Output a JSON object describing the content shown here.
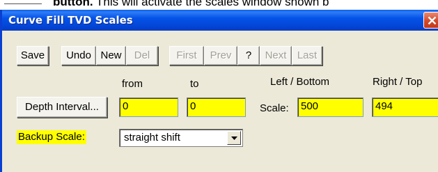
{
  "document": {
    "partial_bold": "button.",
    "partial_text": " This will activate the scales window shown b"
  },
  "window": {
    "title": "Curve Fill TVD Scales"
  },
  "toolbar": {
    "save_label": "Save",
    "undo_label": "Undo",
    "new_label": "New",
    "del_label": "Del",
    "first_label": "First",
    "prev_label": "Prev",
    "help_label": "?",
    "next_label": "Next",
    "last_label": "Last"
  },
  "depth": {
    "button_label": "Depth Interval...",
    "from_label": "from",
    "to_label": "to",
    "from_value": "0",
    "to_value": "0"
  },
  "scale": {
    "label": "Scale:",
    "left_bottom_label": "Left / Bottom",
    "right_top_label": "Right / Top",
    "left_bottom_value": "500",
    "right_top_value": "494"
  },
  "backup": {
    "label": "Backup Scale:",
    "selected": "straight shift"
  },
  "colors": {
    "title_bar": "#0553e8",
    "highlight": "#ffff00",
    "dialog_bg": "#ece9d8",
    "close_button": "#d2492a"
  },
  "icons": {
    "close": "close-icon",
    "dropdown": "chevron-down-icon"
  }
}
